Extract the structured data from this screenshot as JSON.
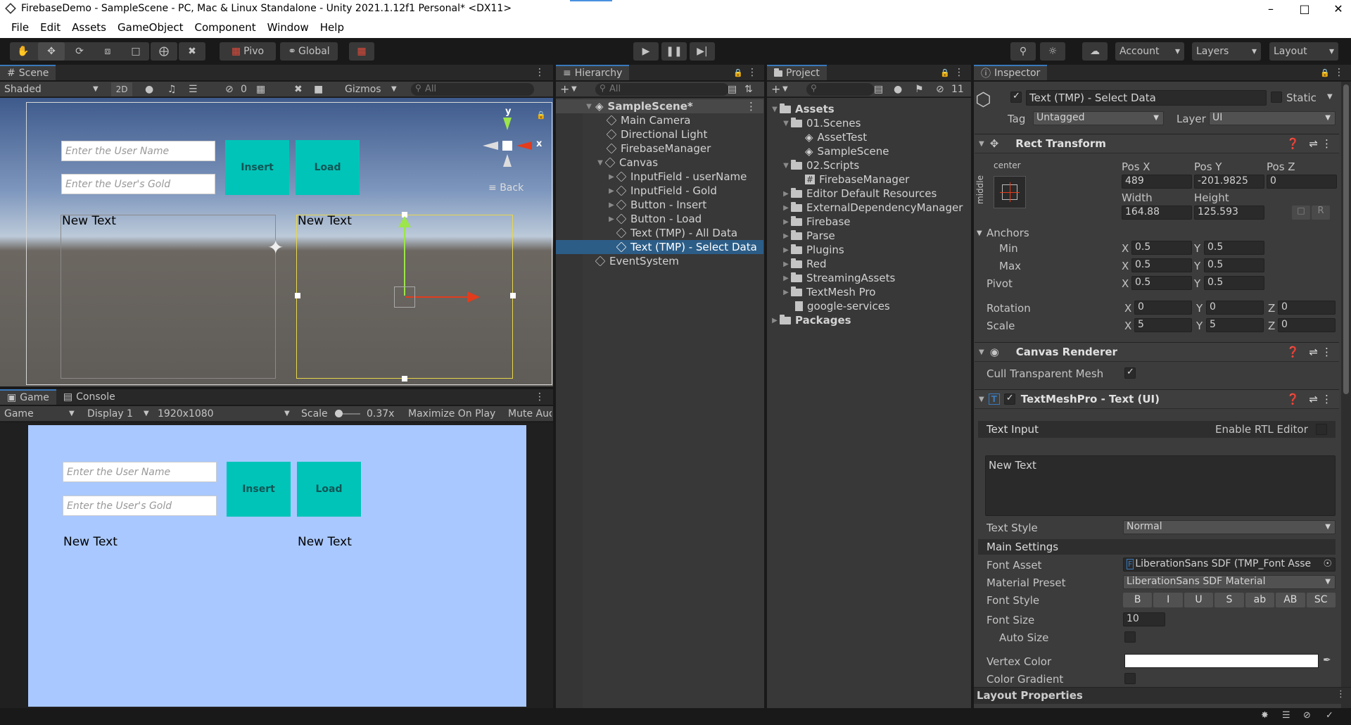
{
  "window": {
    "title": "FirebaseDemo - SampleScene - PC, Mac & Linux Standalone - Unity 2021.1.12f1 Personal* <DX11>"
  },
  "menu": [
    "File",
    "Edit",
    "Assets",
    "GameObject",
    "Component",
    "Window",
    "Help"
  ],
  "toolbar": {
    "pivot_label": "Pivo",
    "global_label": "Global",
    "account": "Account",
    "layers": "Layers",
    "layout": "Layout"
  },
  "scene": {
    "tab": "Scene",
    "shading": "Shaded",
    "mode2d": "2D",
    "gizmos": "Gizmos",
    "search_placeholder": "All",
    "hidden_count": "0",
    "username_placeholder": "Enter the User Name",
    "gold_placeholder": "Enter the User's Gold",
    "insert_label": "Insert",
    "load_label": "Load",
    "new_text_left": "New Text",
    "new_text_right": "New Text",
    "gizmo_y": "y",
    "gizmo_x": "x",
    "back_label": "Back"
  },
  "game": {
    "tab_game": "Game",
    "tab_console": "Console",
    "mode": "Game",
    "display": "Display 1",
    "resolution": "1920x1080",
    "scale_label": "Scale",
    "scale_value": "0.37x",
    "maximize": "Maximize On Play",
    "mute": "Mute Aud",
    "username_placeholder": "Enter the User Name",
    "gold_placeholder": "Enter the User's Gold",
    "insert_label": "Insert",
    "load_label": "Load",
    "new_text_left": "New Text",
    "new_text_right": "New Text",
    "bg_color": "#a9c8ff",
    "button_color": "#00c4b8"
  },
  "hierarchy": {
    "tab": "Hierarchy",
    "search_placeholder": "All",
    "items": [
      {
        "label": "SampleScene*",
        "depth": 0
      },
      {
        "label": "Main Camera",
        "depth": 1
      },
      {
        "label": "Directional Light",
        "depth": 1
      },
      {
        "label": "FirebaseManager",
        "depth": 1
      },
      {
        "label": "Canvas",
        "depth": 1
      },
      {
        "label": "InputField - userName",
        "depth": 2
      },
      {
        "label": "InputField - Gold",
        "depth": 2
      },
      {
        "label": "Button - Insert",
        "depth": 2
      },
      {
        "label": "Button - Load",
        "depth": 2
      },
      {
        "label": "Text (TMP) - All Data",
        "depth": 2
      },
      {
        "label": "Text (TMP) - Select Data",
        "depth": 2
      },
      {
        "label": "EventSystem",
        "depth": 1
      }
    ]
  },
  "project": {
    "tab": "Project",
    "hidden_count": "11",
    "items": [
      {
        "label": "Assets",
        "depth": 0,
        "kind": "folder"
      },
      {
        "label": "01.Scenes",
        "depth": 1,
        "kind": "folder"
      },
      {
        "label": "AssetTest",
        "depth": 2,
        "kind": "scene"
      },
      {
        "label": "SampleScene",
        "depth": 2,
        "kind": "scene"
      },
      {
        "label": "02.Scripts",
        "depth": 1,
        "kind": "folder"
      },
      {
        "label": "FirebaseManager",
        "depth": 2,
        "kind": "script"
      },
      {
        "label": "Editor Default Resources",
        "depth": 1,
        "kind": "folder"
      },
      {
        "label": "ExternalDependencyManager",
        "depth": 1,
        "kind": "folder"
      },
      {
        "label": "Firebase",
        "depth": 1,
        "kind": "folder"
      },
      {
        "label": "Parse",
        "depth": 1,
        "kind": "folder"
      },
      {
        "label": "Plugins",
        "depth": 1,
        "kind": "folder"
      },
      {
        "label": "Red",
        "depth": 1,
        "kind": "folder"
      },
      {
        "label": "StreamingAssets",
        "depth": 1,
        "kind": "folder"
      },
      {
        "label": "TextMesh Pro",
        "depth": 1,
        "kind": "folder"
      },
      {
        "label": "google-services",
        "depth": 1,
        "kind": "file"
      },
      {
        "label": "Packages",
        "depth": 0,
        "kind": "folder"
      }
    ]
  },
  "inspector": {
    "tab": "Inspector",
    "object_name": "Text (TMP) - Select Data",
    "static": "Static",
    "tag_label": "Tag",
    "tag": "Untagged",
    "layer_label": "Layer",
    "layer": "UI",
    "rect": {
      "title": "Rect Transform",
      "anchor_h": "center",
      "anchor_v": "middle",
      "posx_label": "Pos X",
      "posy_label": "Pos Y",
      "posz_label": "Pos Z",
      "posx": "489",
      "posy": "-201.9825",
      "posz": "0",
      "width_label": "Width",
      "height_label": "Height",
      "width": "164.88",
      "height": "125.593",
      "r_label": "R",
      "anchors": "Anchors",
      "min": "Min",
      "max": "Max",
      "pivot": "Pivot",
      "rotation": "Rotation",
      "scale": "Scale",
      "min_x": "0.5",
      "min_y": "0.5",
      "max_x": "0.5",
      "max_y": "0.5",
      "pivot_x": "0.5",
      "pivot_y": "0.5",
      "rot_x": "0",
      "rot_y": "0",
      "rot_z": "0",
      "scale_x": "5",
      "scale_y": "5",
      "scale_z": "0",
      "x": "X",
      "y": "Y",
      "z": "Z"
    },
    "canvas_renderer": {
      "title": "Canvas Renderer",
      "cull": "Cull Transparent Mesh"
    },
    "tmp": {
      "title": "TextMeshPro - Text (UI)",
      "text_input": "Text Input",
      "rtl": "Enable RTL Editor",
      "text": "New Text",
      "text_style_label": "Text Style",
      "text_style": "Normal",
      "main_settings": "Main Settings",
      "font_asset_label": "Font Asset",
      "font_asset": "LiberationSans SDF (TMP_Font Asse",
      "material_label": "Material Preset",
      "material": "LiberationSans SDF Material",
      "font_style_label": "Font Style",
      "styles": [
        "B",
        "I",
        "U",
        "S",
        "ab",
        "AB",
        "SC"
      ],
      "font_size_label": "Font Size",
      "font_size": "10",
      "auto_size": "Auto Size",
      "vertex_color": "Vertex Color",
      "color_gradient": "Color Gradient",
      "layout": "Layout Properties"
    }
  }
}
